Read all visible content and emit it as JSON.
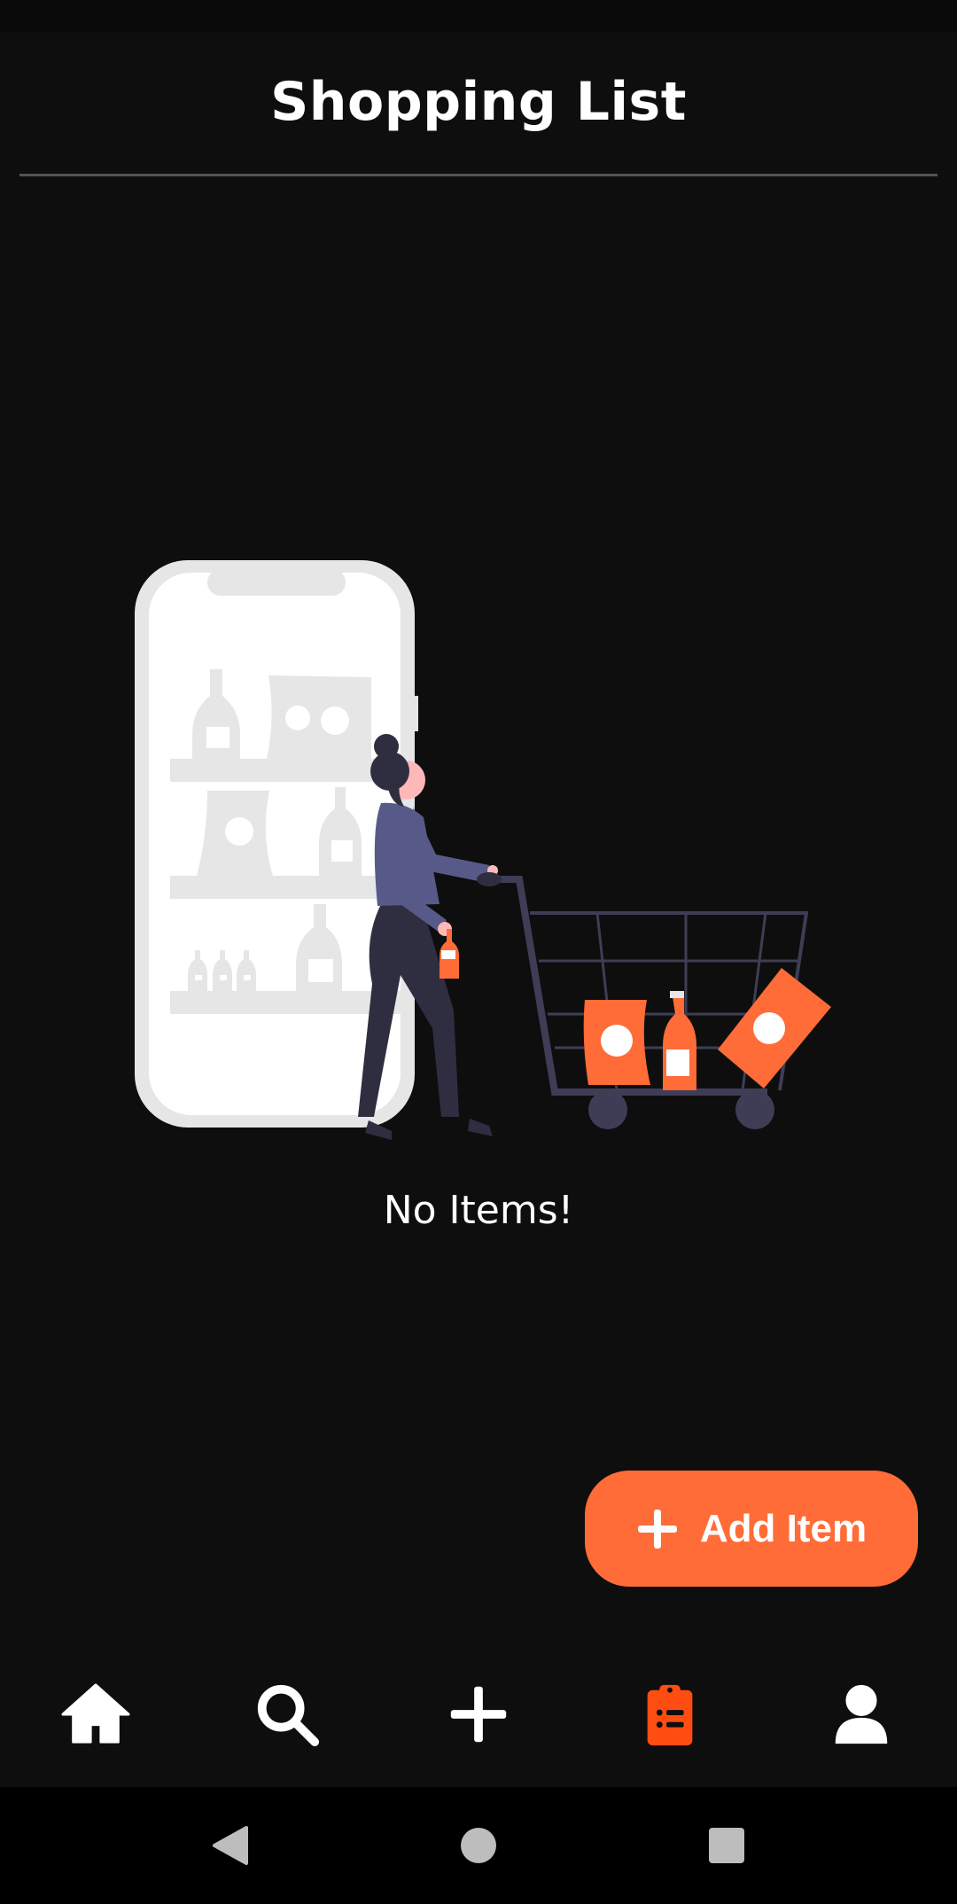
{
  "header": {
    "title": "Shopping List"
  },
  "empty_state": {
    "message": "No Items!"
  },
  "fab": {
    "label": "Add Item",
    "icon": "plus-icon"
  },
  "bottom_nav": {
    "items": [
      {
        "name": "home",
        "icon": "home-icon",
        "active": false
      },
      {
        "name": "search",
        "icon": "search-icon",
        "active": false
      },
      {
        "name": "add",
        "icon": "plus-icon",
        "active": false
      },
      {
        "name": "shopping-list",
        "icon": "clipboard-list-icon",
        "active": true
      },
      {
        "name": "profile",
        "icon": "user-icon",
        "active": false
      }
    ]
  },
  "colors": {
    "background": "#0e0e0e",
    "accent": "#ff6c37",
    "text": "#ffffff",
    "divider": "#555555"
  }
}
